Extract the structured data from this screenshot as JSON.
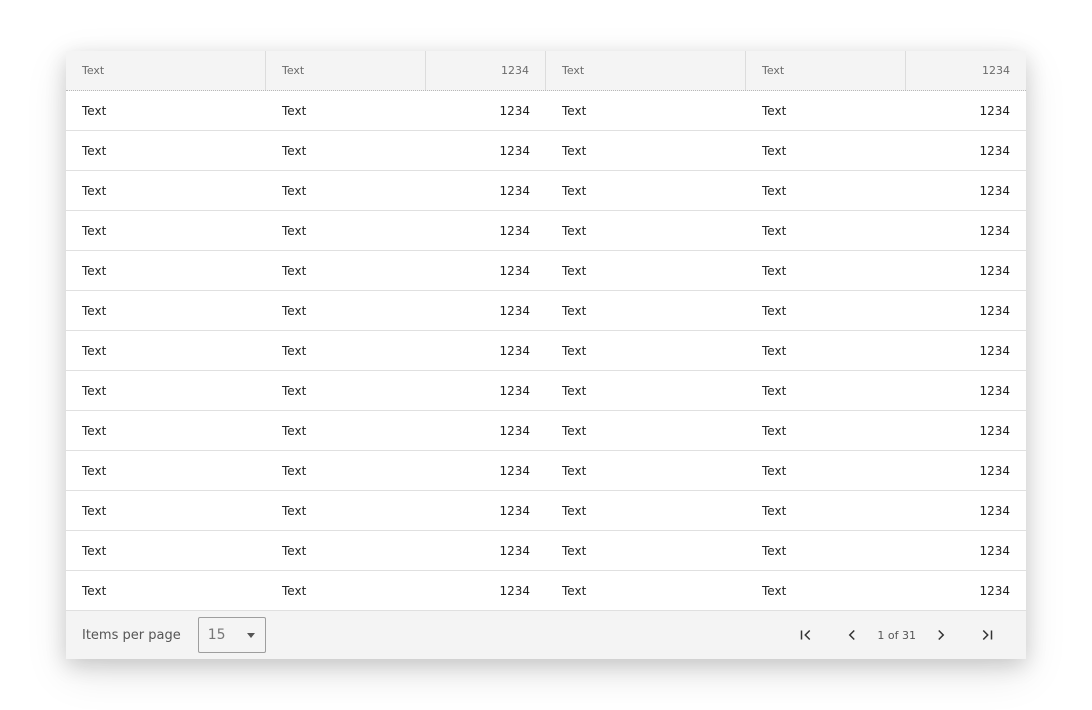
{
  "table": {
    "columns": [
      {
        "label": "Text"
      },
      {
        "label": "Text"
      },
      {
        "label": "1234"
      },
      {
        "label": "Text"
      },
      {
        "label": "Text"
      },
      {
        "label": "1234"
      }
    ],
    "rows": [
      [
        "Text",
        "Text",
        "1234",
        "Text",
        "Text",
        "1234"
      ],
      [
        "Text",
        "Text",
        "1234",
        "Text",
        "Text",
        "1234"
      ],
      [
        "Text",
        "Text",
        "1234",
        "Text",
        "Text",
        "1234"
      ],
      [
        "Text",
        "Text",
        "1234",
        "Text",
        "Text",
        "1234"
      ],
      [
        "Text",
        "Text",
        "1234",
        "Text",
        "Text",
        "1234"
      ],
      [
        "Text",
        "Text",
        "1234",
        "Text",
        "Text",
        "1234"
      ],
      [
        "Text",
        "Text",
        "1234",
        "Text",
        "Text",
        "1234"
      ],
      [
        "Text",
        "Text",
        "1234",
        "Text",
        "Text",
        "1234"
      ],
      [
        "Text",
        "Text",
        "1234",
        "Text",
        "Text",
        "1234"
      ],
      [
        "Text",
        "Text",
        "1234",
        "Text",
        "Text",
        "1234"
      ],
      [
        "Text",
        "Text",
        "1234",
        "Text",
        "Text",
        "1234"
      ],
      [
        "Text",
        "Text",
        "1234",
        "Text",
        "Text",
        "1234"
      ],
      [
        "Text",
        "Text",
        "1234",
        "Text",
        "Text",
        "1234"
      ]
    ]
  },
  "footer": {
    "items_per_page_label": "Items per page",
    "items_per_page_value": "15",
    "page_info": "1 of 31",
    "icons": {
      "first": "first-page-icon",
      "prev": "chevron-left-icon",
      "next": "chevron-right-icon",
      "last": "last-page-icon",
      "dropdown": "caret-down-icon"
    }
  },
  "colors": {
    "header_bg": "#f4f4f4",
    "row_border": "#e0e0e0",
    "text": "#1f1f1f",
    "muted": "#6b6b6b"
  }
}
